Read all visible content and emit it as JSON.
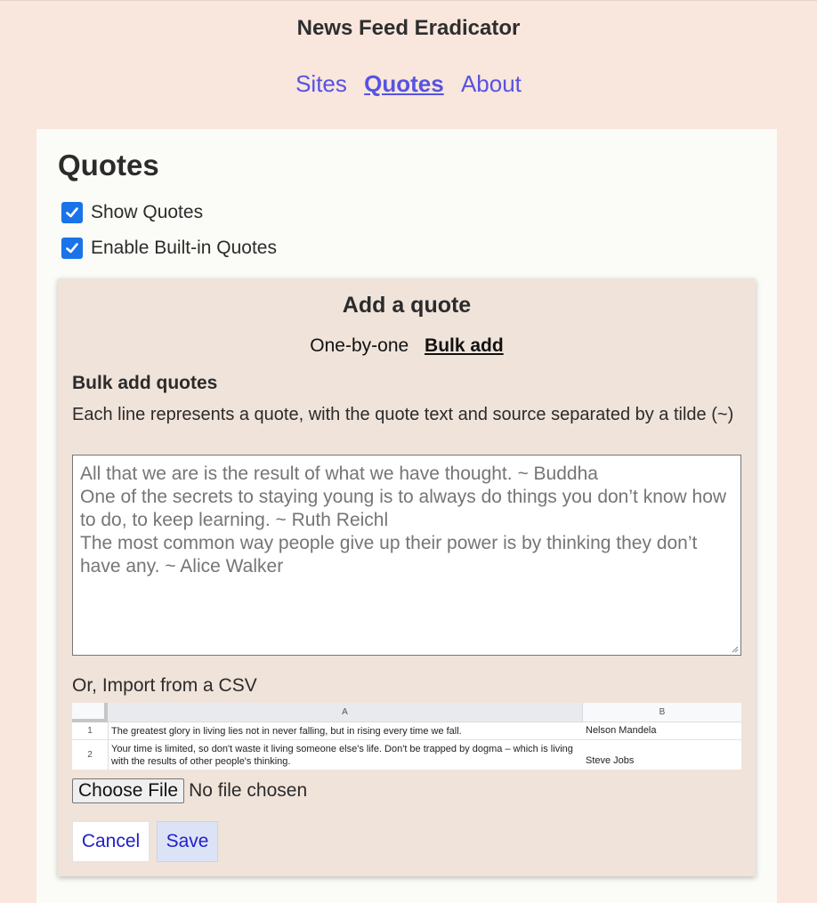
{
  "app": {
    "title": "News Feed Eradicator"
  },
  "nav": {
    "items": [
      {
        "label": "Sites",
        "active": false
      },
      {
        "label": "Quotes",
        "active": true
      },
      {
        "label": "About",
        "active": false
      }
    ]
  },
  "page": {
    "title": "Quotes",
    "options": [
      {
        "label": "Show Quotes",
        "checked": true
      },
      {
        "label": "Enable Built-in Quotes",
        "checked": true
      }
    ]
  },
  "add_quote": {
    "title": "Add a quote",
    "modes": [
      {
        "label": "One-by-one",
        "active": false
      },
      {
        "label": "Bulk add",
        "active": true
      }
    ],
    "bulk": {
      "heading": "Bulk add quotes",
      "description": "Each line represents a quote, with the quote text and source separated by a tilde (~)",
      "placeholder_lines": [
        "All that we are is the result of what we have thought. ~ Buddha",
        "One of the secrets to staying young is to always do things you don’t know how to do, to keep learning. ~ Ruth Reichl",
        "The most common way people give up their power is by thinking they don’t have any. ~ Alice Walker"
      ],
      "import_label": "Or, Import from a CSV",
      "csv_example": {
        "columns": [
          "A",
          "B"
        ],
        "rows": [
          {
            "num": "1",
            "a": "The greatest glory in living lies not in never falling, but in rising every time we fall.",
            "b": "Nelson Mandela"
          },
          {
            "num": "2",
            "a": "Your time is limited, so don't waste it living someone else's life. Don't be trapped by dogma – which is living with the results of other people's thinking.",
            "b": "Steve Jobs"
          }
        ]
      },
      "file_input": {
        "button_label": "Choose File",
        "status": "No file chosen"
      }
    },
    "actions": {
      "cancel_label": "Cancel",
      "save_label": "Save"
    }
  },
  "colors": {
    "link": "#5753e0",
    "background": "#f9e6dd",
    "panel": "#f0e3da",
    "checkbox": "#1a73e8"
  }
}
